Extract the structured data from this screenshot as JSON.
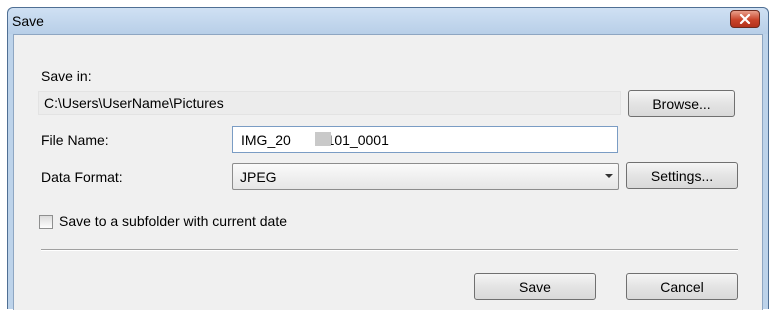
{
  "window": {
    "title": "Save",
    "close_icon": "close-x-icon",
    "accent": "#c9442a"
  },
  "save_in": {
    "label": "Save in:",
    "path": "C:\\Users\\UserName\\Pictures",
    "browse_label": "Browse..."
  },
  "file_name": {
    "label": "File Name:",
    "value": "IMG_20  0101_0001"
  },
  "data_format": {
    "label": "Data Format:",
    "selected": "JPEG",
    "dropdown_icon": "chevron-down-icon",
    "settings_label": "Settings..."
  },
  "subfolder": {
    "label": "Save to a subfolder with current date",
    "checked": false
  },
  "buttons": {
    "save_label": "Save",
    "cancel_label": "Cancel"
  }
}
